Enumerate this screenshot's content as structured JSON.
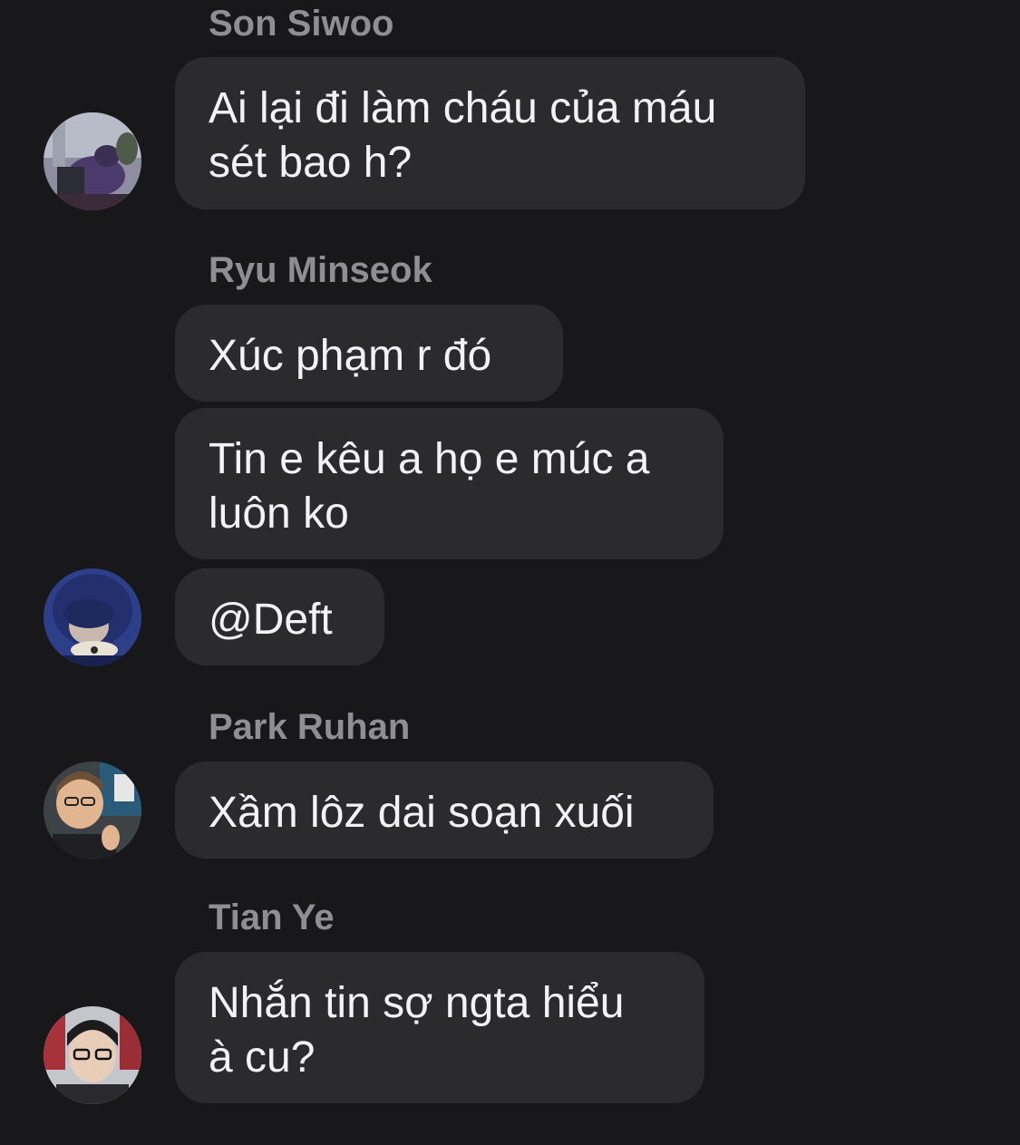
{
  "messages": [
    {
      "sender": "Son Siwoo",
      "text": "Ai lại đi làm cháu của máu\nsét bao h?"
    },
    {
      "sender": "Ryu Minseok",
      "text": "Xúc phạm r đó"
    },
    {
      "text": "Tin e kêu a họ e múc a\nluôn ko"
    },
    {
      "text": "@Deft"
    },
    {
      "sender": "Park Ruhan",
      "text": "Xầm lôz dai soạn xuối"
    },
    {
      "sender": "Tian Ye",
      "text": "Nhắn tin sợ ngta hiểu\nà cu?"
    }
  ],
  "colors": {
    "background": "#18181a",
    "bubble": "#2b2b2e",
    "sender_name": "#8e8e93",
    "message_text": "#f2f2f7"
  }
}
